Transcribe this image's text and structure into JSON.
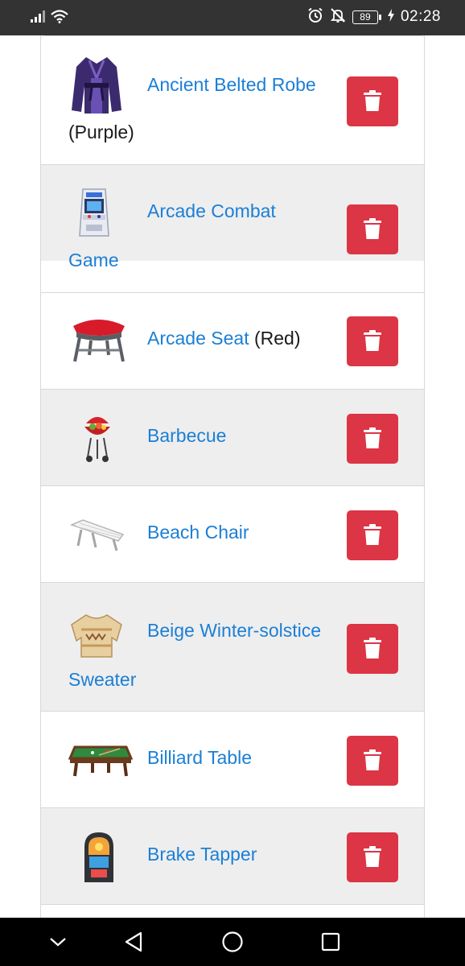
{
  "status_bar": {
    "time": "02:28",
    "battery": "89",
    "icons": [
      "signal-icon",
      "wifi-icon",
      "alarm-icon",
      "mute-bell-icon",
      "charging-icon"
    ]
  },
  "items": [
    {
      "name": "Ancient Belted Robe",
      "variant": "(Purple)",
      "icon": "robe-icon"
    },
    {
      "name": "Arcade Combat Game",
      "variant": "",
      "icon": "arcade-cabinet-icon"
    },
    {
      "name": "Arcade Seat",
      "variant": "(Red)",
      "icon": "stool-icon"
    },
    {
      "name": "Barbecue",
      "variant": "",
      "icon": "grill-icon"
    },
    {
      "name": "Beach Chair",
      "variant": "",
      "icon": "beach-chair-icon"
    },
    {
      "name": "Beige Winter-solstice Sweater",
      "variant": "",
      "icon": "sweater-icon"
    },
    {
      "name": "Billiard Table",
      "variant": "",
      "icon": "billiard-table-icon"
    },
    {
      "name": "Brake Tapper",
      "variant": "",
      "icon": "jukebox-icon"
    }
  ],
  "delete_icon": "trash-icon",
  "colors": {
    "link": "#1b7fd6",
    "delete_button": "#dc3545",
    "row_alt": "#eeeeee",
    "status_bar": "#333333",
    "nav_bar": "#000000"
  },
  "nav_bar": {
    "buttons": [
      "collapse-chevron-icon",
      "back-icon",
      "home-icon",
      "recents-icon"
    ]
  }
}
